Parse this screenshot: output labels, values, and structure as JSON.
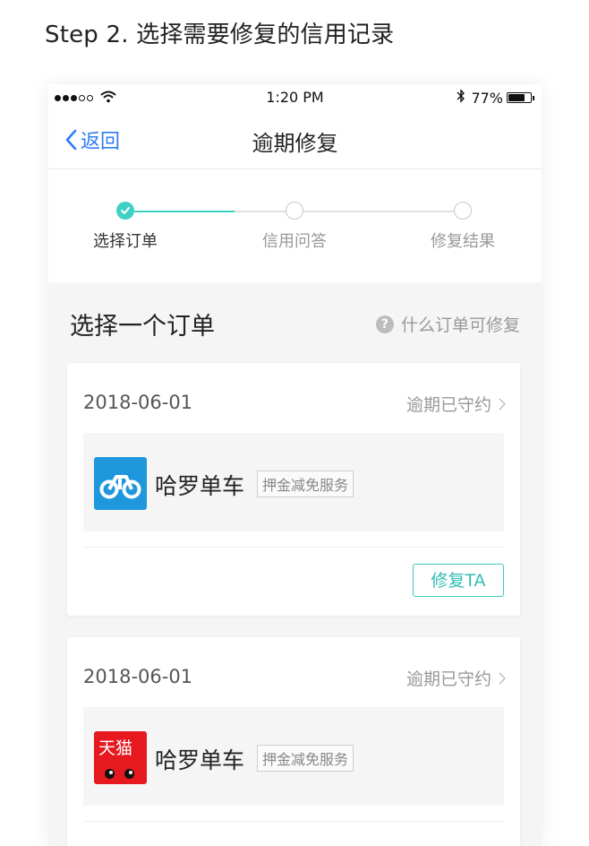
{
  "caption": "Step 2. 选择需要修复的信用记录",
  "status_bar": {
    "time": "1:20 PM",
    "battery_text": "77%",
    "battery_level": 0.77,
    "signal_bars_filled": 3,
    "signal_bars_total": 5
  },
  "nav": {
    "back_label": "返回",
    "title": "逾期修复"
  },
  "steps": [
    {
      "label": "选择订单",
      "state": "done"
    },
    {
      "label": "信用问答",
      "state": "todo"
    },
    {
      "label": "修复结果",
      "state": "todo"
    }
  ],
  "section": {
    "title": "选择一个订单",
    "help_label": "什么订单可修复",
    "help_icon": "?"
  },
  "orders": [
    {
      "date": "2018-06-01",
      "status": "逾期已守约",
      "merchant_name": "哈罗单车",
      "service_tag": "押金减免服务",
      "logo": "bike-icon",
      "action_label": "修复TA"
    },
    {
      "date": "2018-06-01",
      "status": "逾期已守约",
      "merchant_name": "哈罗单车",
      "service_tag": "押金减免服务",
      "logo": "tmall-icon",
      "logo_text": "天猫"
    }
  ],
  "colors": {
    "accent": "#3fd0c4",
    "link": "#2f7cf6",
    "bike_logo": "#1f97dd",
    "tmall_logo": "#e5191f"
  }
}
